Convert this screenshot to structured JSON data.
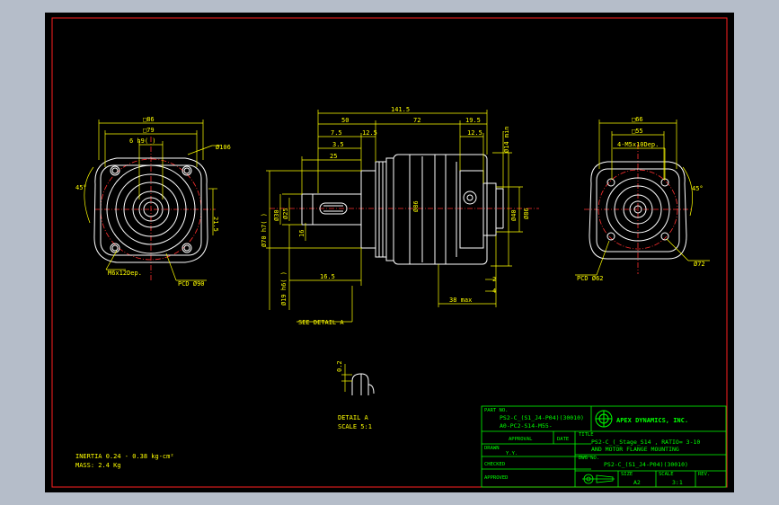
{
  "colors": {
    "background": "#000000",
    "frame": "#ff2020",
    "geometry": "#ffffff",
    "dimension": "#ffff00",
    "centerline": "#ff3030",
    "titleblock": "#00ff00",
    "outside": "#b5bdc9"
  },
  "left_view": {
    "dims": [
      "□86",
      "□79",
      "6 h9(  )",
      "Ø106",
      "45°",
      "21.5",
      "M6x12Dep.",
      "PCD Ø90"
    ]
  },
  "center_view": {
    "top_dims": [
      "141.5",
      "50",
      "72",
      "19.5",
      "7.5",
      "12.5",
      "12.5",
      "3.5",
      "25"
    ],
    "left_dims": [
      "Ø70 h7(  )",
      "Ø30",
      "Ø25",
      "Ø19 h6(  )",
      "16"
    ],
    "right_dims": [
      "Ø86",
      "Ø14 min",
      "Ø40",
      "Ø86",
      "2",
      "4",
      "38 max"
    ],
    "bottom_dims": [
      "16.5"
    ],
    "see_detail": "SEE DETAIL A"
  },
  "right_view": {
    "dims": [
      "□66",
      "□55",
      "4-M5x10Dep.",
      "45°",
      "Ø72",
      "PCD Ø62"
    ]
  },
  "detail": {
    "dim": "0.2",
    "title": "DETAIL A",
    "scale": "SCALE 5:1"
  },
  "notes": {
    "inertia": "INERTIA  0.24 - 0.38 kg-cm²",
    "mass": "MASS: 2.4  Kg"
  },
  "titleblock": {
    "part_no_label": "PART NO.",
    "part_no_1": "PS2-C_(S1_J4-P04)(30010)",
    "part_no_2": "A0-PC2-S14-M55-",
    "company": "APEX DYNAMICS, INC.",
    "approval_label": "APPROVAL",
    "date_label": "DATE",
    "title_label": "TITLE",
    "title_1": "PS2-C_(_Stage_S14 , RATIO= 3-10",
    "title_2": "AND MOTOR FLANGE MOUNTING",
    "drawn_label": "DRAWN",
    "drawn_value": "Y.Y.",
    "dwg_no_label": "DWG NO.",
    "dwg_no": "PS2-C_(S1_J4-P04)(30010)",
    "checked_label": "CHECKED",
    "approved_label": "APPROVED",
    "size_label": "SIZE",
    "size": "A2",
    "scale_label": "SCALE",
    "scale": "3:1",
    "rev_label": "REV."
  }
}
